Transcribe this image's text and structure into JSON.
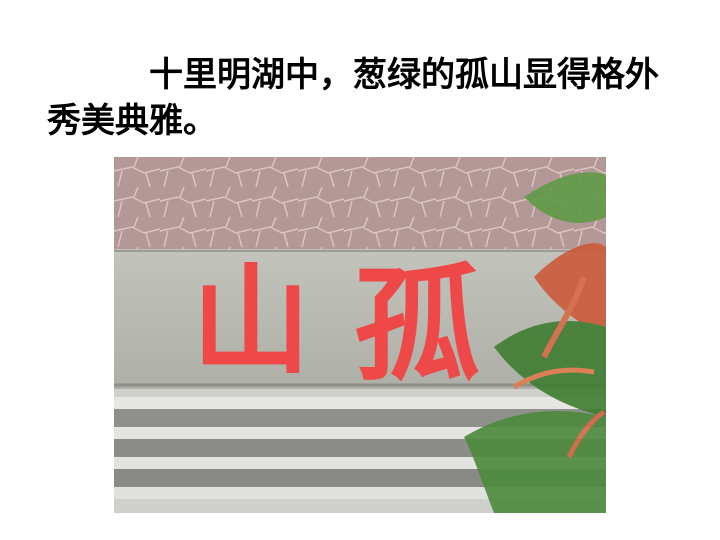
{
  "slide": {
    "text": "十里明湖中，葱绿的孤山显得格外秀美典雅。"
  },
  "photo": {
    "inscription": [
      "山",
      "孤"
    ],
    "colors": {
      "wall_stone": "#b09090",
      "wall_panel": "#c9c8c0",
      "inscription_red": "#ef4848",
      "steps": "#d8d8d4",
      "foliage": "#4a8a3a"
    }
  }
}
